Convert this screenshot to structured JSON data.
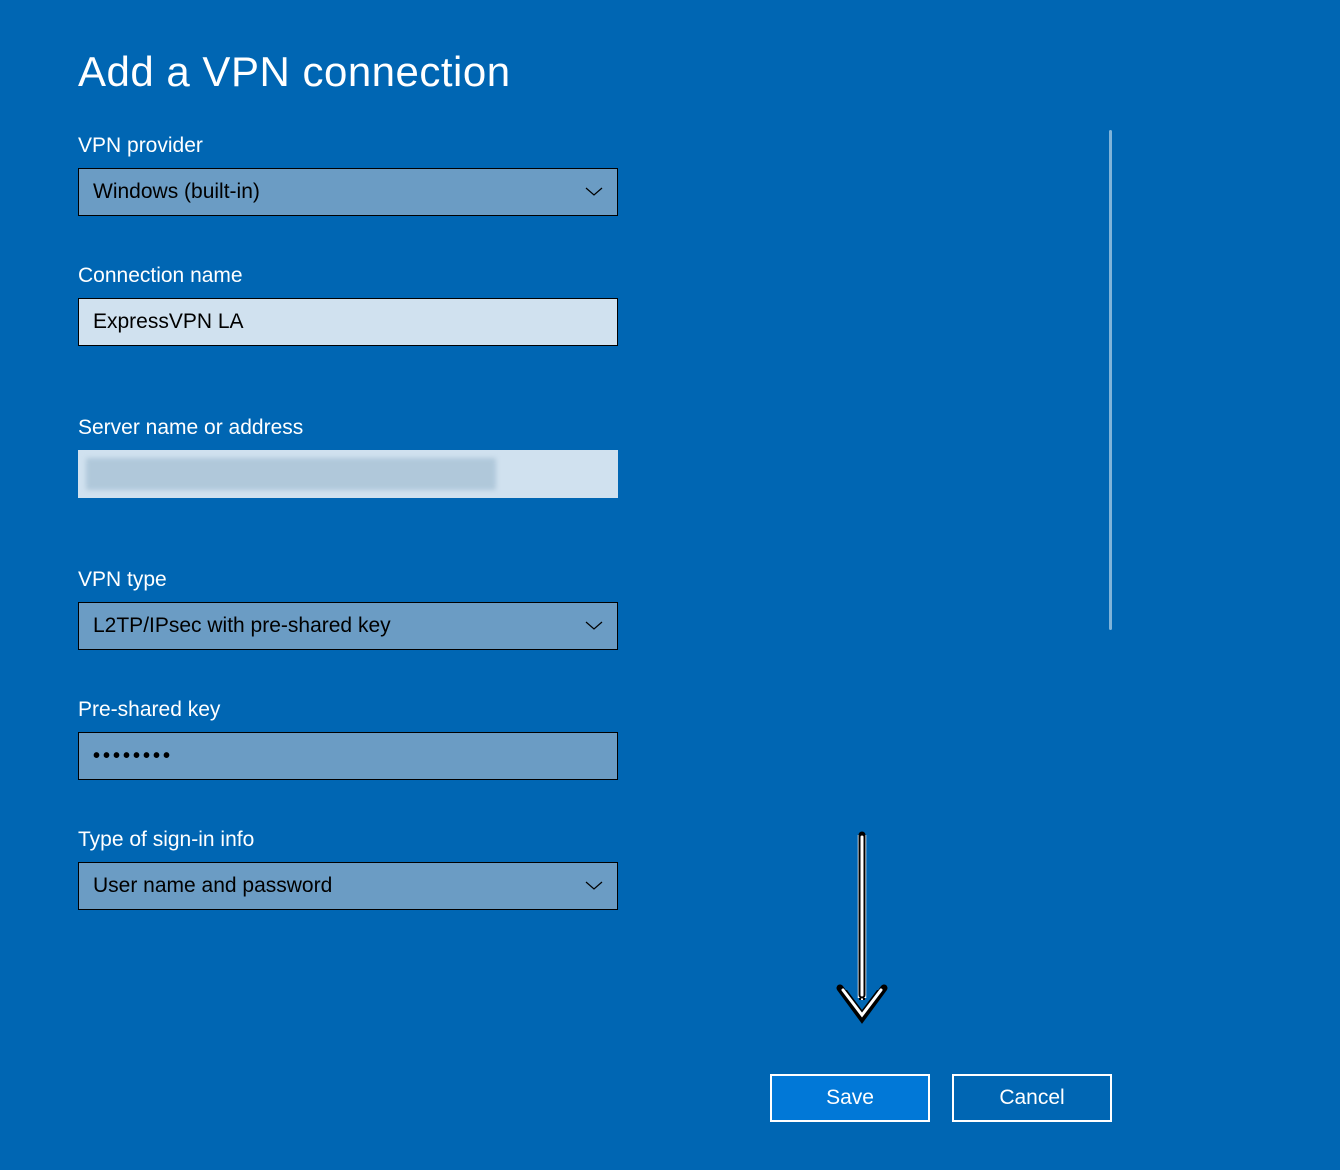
{
  "title": "Add a VPN connection",
  "fields": {
    "vpn_provider": {
      "label": "VPN provider",
      "value": "Windows (built-in)"
    },
    "connection_name": {
      "label": "Connection name",
      "value": "ExpressVPN LA"
    },
    "server_address": {
      "label": "Server name or address",
      "value": ""
    },
    "vpn_type": {
      "label": "VPN type",
      "value": "L2TP/IPsec with pre-shared key"
    },
    "preshared_key": {
      "label": "Pre-shared key",
      "value": "••••••••"
    },
    "signin_type": {
      "label": "Type of sign-in info",
      "value": "User name and password"
    }
  },
  "buttons": {
    "save": "Save",
    "cancel": "Cancel"
  }
}
